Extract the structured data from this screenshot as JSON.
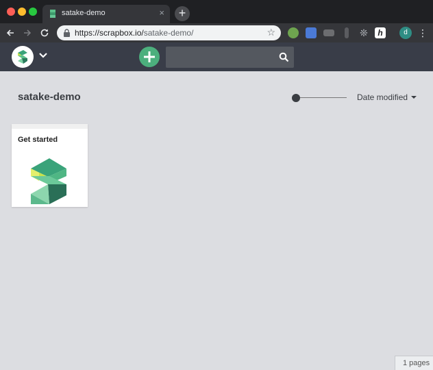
{
  "browser": {
    "tab_title": "satake-demo",
    "tab_close": "×",
    "new_tab": "+",
    "url_host": "https://scrapbox.io/",
    "url_path": "satake-demo/",
    "star": "☆",
    "profile_initial": "d",
    "ext_h": "h",
    "ext_bug": "❊",
    "menu": "⋮"
  },
  "app": {
    "project_title": "satake-demo",
    "sort_label": "Date modified",
    "search_placeholder": "",
    "zoom_level": 0
  },
  "pages": [
    {
      "title": "Get started"
    }
  ],
  "footer": {
    "page_count": "1 pages"
  },
  "colors": {
    "accent_green": "#4caf7d",
    "header_bg": "#393d48",
    "page_bg": "#dcdde1"
  }
}
